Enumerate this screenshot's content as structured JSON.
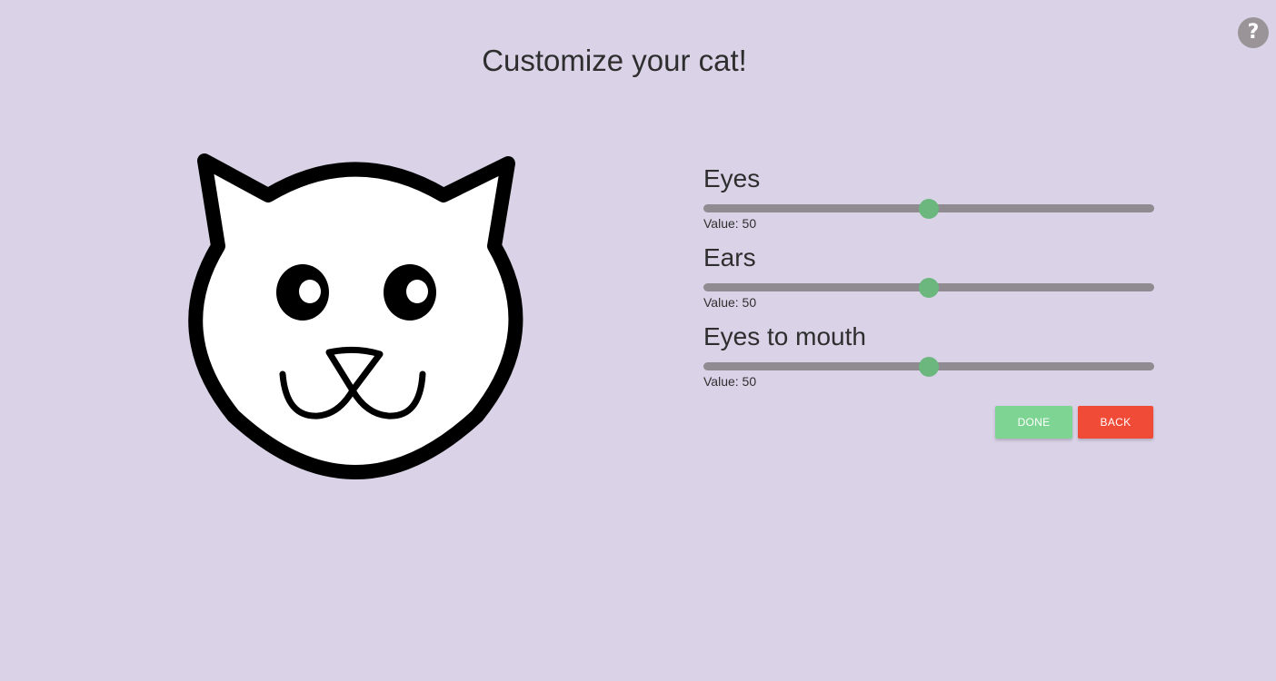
{
  "header": {
    "title": "Customize your cat!",
    "help_label": "?"
  },
  "controls": [
    {
      "label": "Eyes",
      "value_text": "Value: 50",
      "value": 50,
      "min": 0,
      "max": 100
    },
    {
      "label": "Ears",
      "value_text": "Value: 50",
      "value": 50,
      "min": 0,
      "max": 100
    },
    {
      "label": "Eyes to mouth",
      "value_text": "Value: 50",
      "value": 50,
      "min": 0,
      "max": 100
    }
  ],
  "actions": {
    "done_label": "DONE",
    "back_label": "BACK"
  },
  "colors": {
    "background": "#dad3e8",
    "slider_track": "#8f8b90",
    "slider_thumb": "#6bb77e",
    "done_button": "#7ed493",
    "back_button": "#f04b37",
    "help_button": "#9a9498"
  }
}
